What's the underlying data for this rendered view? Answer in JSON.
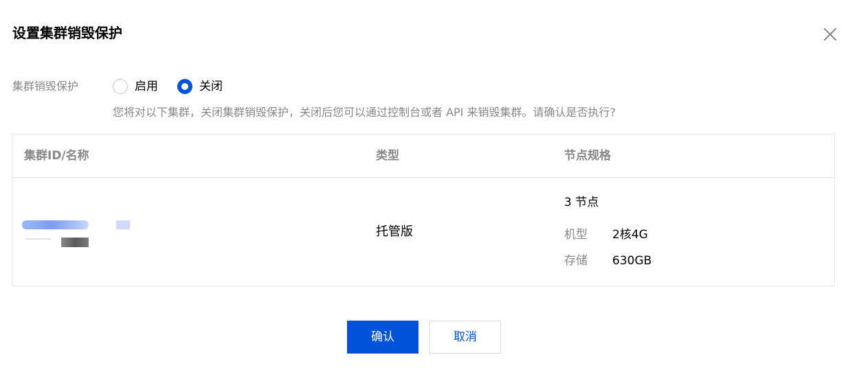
{
  "dialog": {
    "title": "设置集群销毁保护"
  },
  "protection": {
    "label": "集群销毁保护",
    "options": [
      {
        "label": "启用",
        "checked": false
      },
      {
        "label": "关闭",
        "checked": true
      }
    ],
    "hint": "您将对以下集群，关闭集群销毁保护，关闭后您可以通过控制台或者 API 来销毁集群。请确认是否执行?"
  },
  "table": {
    "headers": [
      "集群ID/名称",
      "类型",
      "节点规格"
    ],
    "rows": [
      {
        "type": "托管版",
        "node_count": "3 节点",
        "specs": [
          {
            "key": "机型",
            "value": "2核4G"
          },
          {
            "key": "存储",
            "value": "630GB"
          }
        ]
      }
    ]
  },
  "footer": {
    "confirm_label": "确认",
    "cancel_label": "取消"
  },
  "colors": {
    "primary": "#0052d9",
    "muted_text": "#888888",
    "border": "#e7e7e7"
  },
  "icons": {
    "close": "close-icon"
  }
}
